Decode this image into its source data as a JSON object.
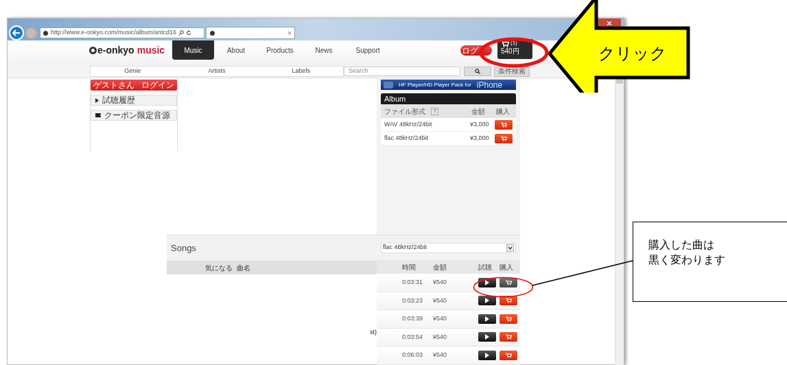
{
  "browser": {
    "address": "http://www.e-onkyo.com/music/album/antcd16",
    "tab_close": "×"
  },
  "site": {
    "logo": "e-onkyo",
    "logo_accent": "music",
    "nav": [
      {
        "label": "Music",
        "selected": true
      },
      {
        "label": "About",
        "selected": false
      },
      {
        "label": "Products",
        "selected": false
      },
      {
        "label": "News",
        "selected": false
      },
      {
        "label": "Support",
        "selected": false
      }
    ],
    "login": "ログ",
    "cart": {
      "count": "(1)",
      "total": "540円"
    },
    "subnav": [
      "Genie",
      "Artists",
      "Labels"
    ],
    "search": {
      "placeholder": "Search"
    },
    "advanced_search": "条件検索"
  },
  "sidebar": {
    "guest": "ゲストさん",
    "guest_login": "ログイン",
    "items": [
      {
        "kind": "history",
        "label": "試聴履歴"
      },
      {
        "kind": "coupon",
        "label": "クーポン限定音源"
      }
    ]
  },
  "banner": {
    "text": "HF Player/HD Player Pack for",
    "accent": "iPhone"
  },
  "album": {
    "title": "Album",
    "columns": [
      "ファイル形式",
      "金額",
      "購入"
    ],
    "help": "?",
    "rows": [
      {
        "format": "WAV 48kHz/24bit",
        "price": "¥3,000"
      },
      {
        "format": "flac 48kHz/24bit",
        "price": "¥3,000"
      }
    ]
  },
  "songs": {
    "title": "Songs",
    "columns": [
      "気になる",
      "曲名"
    ],
    "format": "flac 48kHz/24bit",
    "track_columns": [
      "時間",
      "金額",
      "試聴",
      "購入"
    ],
    "tracks": [
      {
        "time": "0:03:31",
        "price": "¥540",
        "purchased": true
      },
      {
        "time": "0:03:23",
        "price": "¥540",
        "purchased": false
      },
      {
        "time": "0:03:39",
        "price": "¥540",
        "purchased": false
      },
      {
        "title": "st)",
        "time": "0:03:54",
        "price": "¥540",
        "purchased": false
      },
      {
        "time": "0:06:03",
        "price": "¥540",
        "purchased": false
      }
    ]
  },
  "annotations": {
    "click": "クリック",
    "note": [
      "購入した曲は",
      "黒く変わります"
    ]
  }
}
